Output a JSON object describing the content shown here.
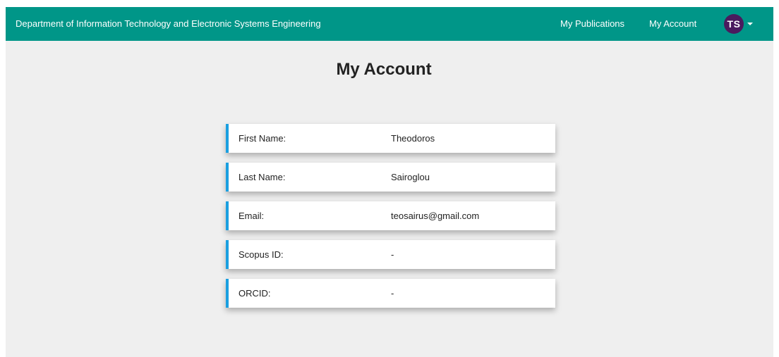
{
  "navbar": {
    "brand": "Department of Information Technology and Electronic Systems Engineering",
    "links": [
      {
        "label": "My Publications"
      },
      {
        "label": "My Account"
      }
    ],
    "user": {
      "initials": "TS",
      "avatar_color": "#4a1a5e"
    },
    "background_color": "#009688"
  },
  "page": {
    "title": "My Account"
  },
  "account_fields": [
    {
      "label": "First Name:",
      "value": "Theodoros"
    },
    {
      "label": "Last Name:",
      "value": "Sairoglou"
    },
    {
      "label": "Email:",
      "value": "teosairus@gmail.com"
    },
    {
      "label": "Scopus ID:",
      "value": "-"
    },
    {
      "label": "ORCID:",
      "value": "-"
    }
  ],
  "accent_color": "#1a9fe0"
}
